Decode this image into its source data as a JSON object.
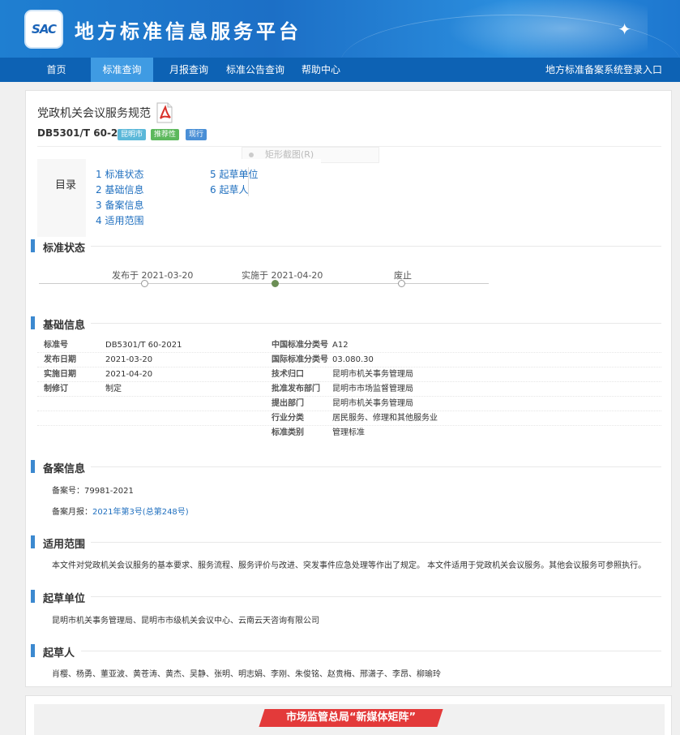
{
  "header": {
    "logo_text": "SAC",
    "site_title": "地方标准信息服务平台"
  },
  "nav": {
    "items": [
      "首页",
      "标准查询",
      "月报查询",
      "标准公告查询",
      "帮助中心"
    ],
    "active": "标准查询",
    "login": "地方标准备案系统登录入口"
  },
  "doc": {
    "title": "党政机关会议服务规范",
    "code": "DB5301/T 60-2021",
    "badges": [
      {
        "text": "昆明市",
        "color": "#5bb8d9"
      },
      {
        "text": "推荐性",
        "color": "#5cb85c"
      },
      {
        "text": "现行",
        "color": "#4a8fd6"
      }
    ],
    "ghost_menu": "矩形截图(R)"
  },
  "toc": {
    "label": "目录",
    "left": [
      "1  标准状态",
      "2  基础信息",
      "3  备案信息",
      "4  适用范围"
    ],
    "right": [
      "5  起草单位",
      "6  起草人"
    ]
  },
  "sections": {
    "status": "标准状态",
    "basic": "基础信息",
    "filing": "备案信息",
    "scope": "适用范围",
    "drafting_unit": "起草单位",
    "drafters": "起草人"
  },
  "timeline": {
    "publish": "发布于 2021-03-20",
    "implement": "实施于 2021-04-20",
    "abolish": "废止"
  },
  "basic_info": {
    "left": [
      {
        "label": "标准号",
        "value": "DB5301/T 60-2021"
      },
      {
        "label": "发布日期",
        "value": "2021-03-20"
      },
      {
        "label": "实施日期",
        "value": "2021-04-20"
      },
      {
        "label": "制修订",
        "value": "制定"
      }
    ],
    "right": [
      {
        "label": "中国标准分类号",
        "value": "A12"
      },
      {
        "label": "国际标准分类号",
        "value": "03.080.30"
      },
      {
        "label": "技术归口",
        "value": "昆明市机关事务管理局"
      },
      {
        "label": "批准发布部门",
        "value": "昆明市市场监督管理局"
      },
      {
        "label": "提出部门",
        "value": "昆明市机关事务管理局"
      },
      {
        "label": "行业分类",
        "value": "居民服务、修理和其他服务业"
      },
      {
        "label": "标准类别",
        "value": "管理标准"
      }
    ]
  },
  "filing": {
    "number_label": "备案号：",
    "number": "79981-2021",
    "monthly_label": "备案月报：",
    "monthly_link": "2021年第3号(总第248号)"
  },
  "scope_text": "本文件对党政机关会议服务的基本要求、服务流程、服务评价与改进、突发事件应急处理等作出了规定。 本文件适用于党政机关会议服务。其他会议服务可参照执行。",
  "drafting_units_text": "昆明市机关事务管理局、昆明市市级机关会议中心、云南云天咨询有限公司",
  "drafters_text": "肖樱、杨勇、董亚波、黄苍涛、黄杰、吴静、张明、明志娟、李刚、朱俊铭、赵贵梅、邢潇子、李昂、柳瑜玲",
  "promo": "市场监管总局“新媒体矩阵”"
}
